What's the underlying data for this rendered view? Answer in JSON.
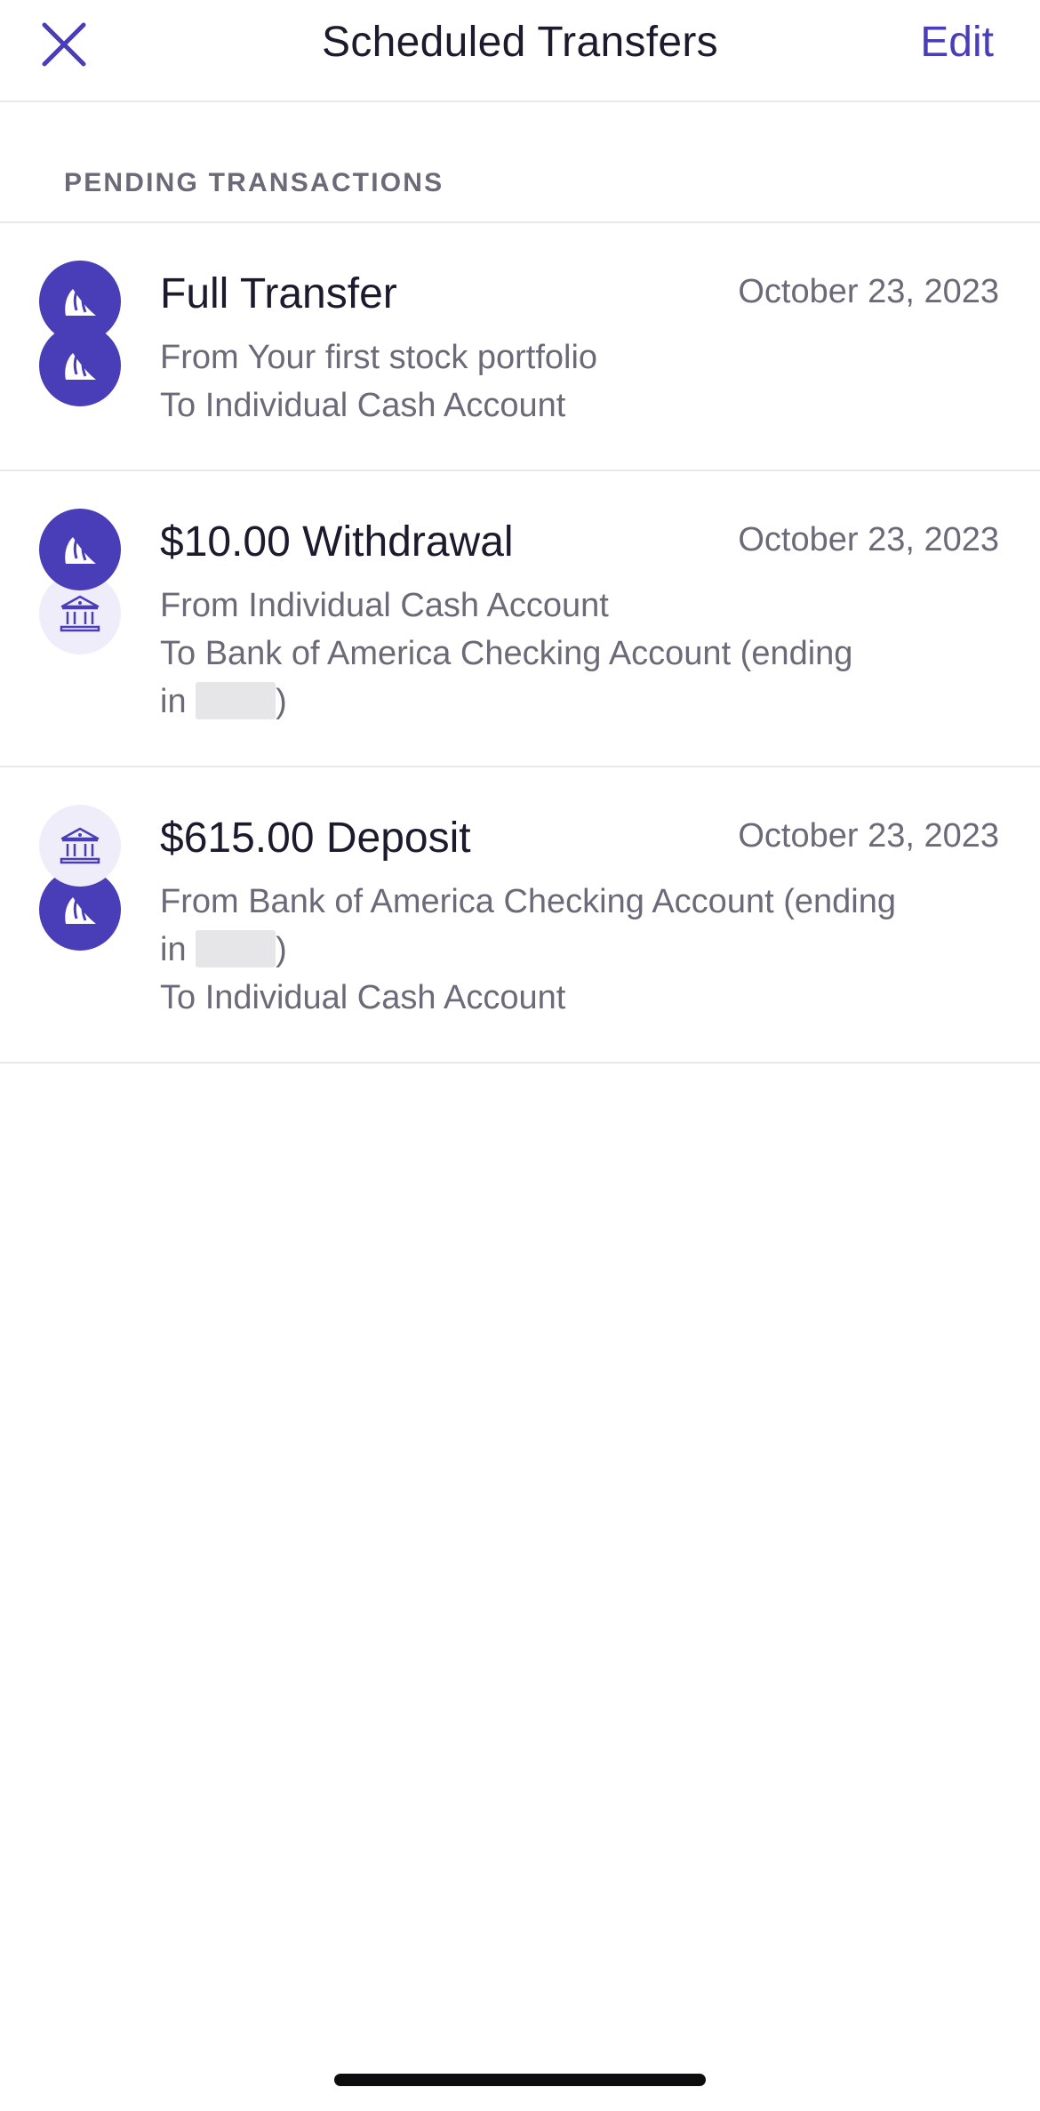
{
  "header": {
    "title": "Scheduled Transfers",
    "edit_label": "Edit",
    "close_icon": "close-icon"
  },
  "section": {
    "label": "PENDING TRANSACTIONS"
  },
  "colors": {
    "brand": "#4a3db8",
    "bank_bg": "#efedf9",
    "text_primary": "#1c1b2e",
    "text_secondary": "#6b6a78",
    "divider": "#e8e8ec"
  },
  "transactions": [
    {
      "title": "Full Transfer",
      "date": "October 23, 2023",
      "from": "From Your first stock portfolio",
      "to": "To Individual Cash Account",
      "from_icon": "brand-logo-icon",
      "to_icon": "brand-logo-icon"
    },
    {
      "title": "$10.00 Withdrawal",
      "date": "October 23, 2023",
      "from": "From Individual Cash Account",
      "to_line1": "To Bank of America Checking Account (ending",
      "to_line2_prefix": "in",
      "to_line2_suffix": ")",
      "from_icon": "brand-logo-icon",
      "to_icon": "bank-icon"
    },
    {
      "title": "$615.00 Deposit",
      "date": "October 23, 2023",
      "from_line1": "From Bank of America Checking Account (ending",
      "from_line2_prefix": "in",
      "from_line2_suffix": ")",
      "to": "To Individual Cash Account",
      "from_icon": "bank-icon",
      "to_icon": "brand-logo-icon"
    }
  ]
}
